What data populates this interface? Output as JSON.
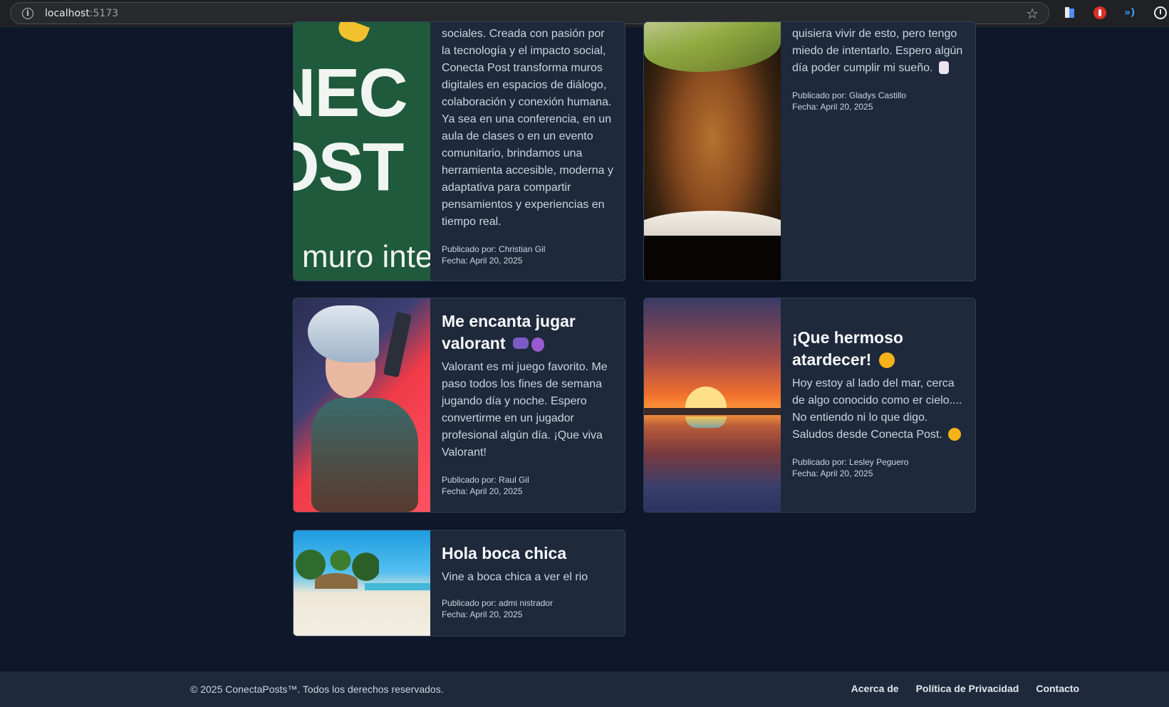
{
  "browser": {
    "url_host": "localhost",
    "url_port": ":5173"
  },
  "posts": [
    {
      "title": "",
      "description": "sociales. Creada con pasión por la tecnología y el impacto social, Conecta Post transforma muros digitales en espacios de diálogo, colaboración y conexión humana. Ya sea en una conferencia, en un aula de clases o en un evento comunitario, brindamos una herramienta accesible, moderna y adaptativa para compartir pensamientos y experiencias en tiempo real.",
      "author": "Publicado por: Christian Gil",
      "date": "Fecha: April 20, 2025",
      "image_text_main": "NEC\nOST",
      "image_text_sub": "muro inte"
    },
    {
      "title": "",
      "description": "quisiera vivir de esto, pero tengo miedo de intentarlo. Espero algún día poder cumplir mi sueño.",
      "author": "Publicado por: Gladys Castillo",
      "date": "Fecha: April 20, 2025"
    },
    {
      "title": "Me encanta jugar valorant",
      "description": "Valorant es mi juego favorito. Me paso todos los fines de semana jugando día y noche. Espero convertirme en un jugador profesional algún día. ¡Que viva Valorant!",
      "author": "Publicado por: Raul Gil",
      "date": "Fecha: April 20, 2025"
    },
    {
      "title": "¡Que hermoso atardecer!",
      "description": "Hoy estoy al lado del mar, cerca de algo conocido como er cielo.... No entiendo ni lo que digo. Saludos desde Conecta Post.",
      "author": "Publicado por: Lesley Peguero",
      "date": "Fecha: April 20, 2025"
    },
    {
      "title": "Hola boca chica",
      "description": "Vine a boca chica a ver el rio",
      "author": "Publicado por: admi nistrador",
      "date": "Fecha: April 20, 2025"
    }
  ],
  "footer": {
    "copyright": "© 2025 ConectaPosts™. Todos los derechos reservados.",
    "links": [
      "Acerca de",
      "Política de Privacidad",
      "Contacto"
    ]
  },
  "colors": {
    "page_bg": "#0f172a",
    "card_bg": "#1e293b",
    "card_border": "#334155"
  }
}
